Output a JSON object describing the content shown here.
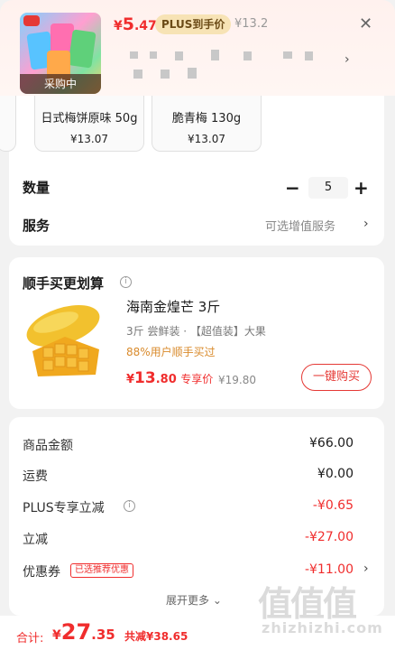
{
  "header": {
    "thumb_status": "采购中",
    "price_symbol": "¥",
    "price_int": "5",
    "price_dec": ".47",
    "plus_tag": "PLUS到手价",
    "original_price": "¥13.2",
    "close_icon": "close-icon",
    "chevron": "›"
  },
  "variants": [
    {
      "name": "日式梅饼原味 50g",
      "price": "¥13.07"
    },
    {
      "name": "脆青梅 130g",
      "price": "¥13.07"
    }
  ],
  "quantity": {
    "label": "数量",
    "minus": "−",
    "value": "5",
    "plus": "+"
  },
  "service": {
    "label": "服务",
    "value": "可选增值服务",
    "chevron": "›"
  },
  "upsell": {
    "title": "顺手买更划算",
    "info_icon": "i",
    "product_name": "海南金煌芒 3斤",
    "desc": "3斤 尝鲜装 · 【超值装】大果",
    "bought": "88%用户顺手买过",
    "price_symbol": "¥",
    "price_int": "13",
    "price_dec": ".80",
    "price_tag": "专享价",
    "original_price": "¥19.80",
    "buy_button": "一键购买"
  },
  "summary": {
    "rows": [
      {
        "label": "商品金额",
        "value": "¥66.00"
      },
      {
        "label": "运费",
        "value": "¥0.00"
      },
      {
        "label": "PLUS专享立减",
        "value": "-¥0.65"
      },
      {
        "label": "立减",
        "value": "-¥27.00"
      },
      {
        "label": "优惠券",
        "value": "-¥11.00"
      }
    ],
    "coupon_tag": "已选推荐优惠",
    "expand": "展开更多 ⌄"
  },
  "footer": {
    "total_label": "合计:",
    "total_symbol": "¥",
    "total_int": "27",
    "total_dec": ".35",
    "total_saved": "共减¥38.65"
  },
  "watermark": {
    "glyphs": "值值值",
    "url": "zhizhizhi.com"
  },
  "colors": {
    "accent_red": "#f02d2d",
    "plus_gold": "#f7e3b5",
    "bought_orange": "#d98a2b"
  }
}
